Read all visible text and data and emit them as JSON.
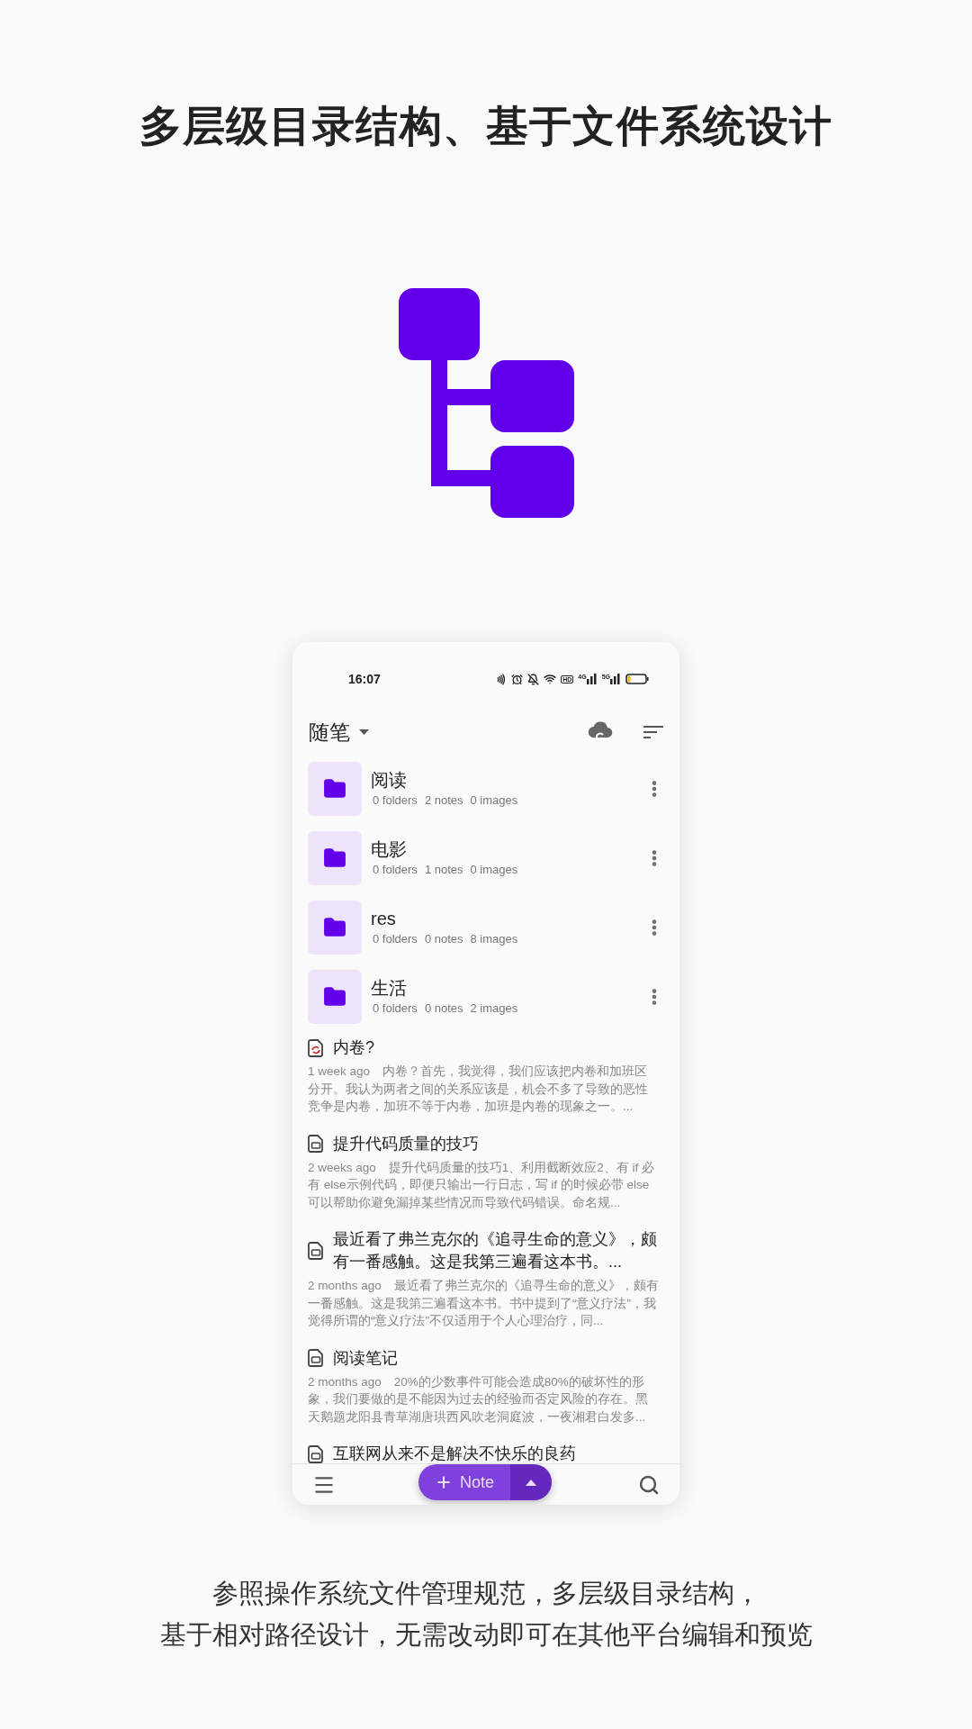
{
  "headline": "多层级目录结构、基于文件系统设计",
  "phone": {
    "status_bar": {
      "time": "16:07",
      "hd_label": "HD",
      "network_labels": [
        "4G",
        "5G"
      ]
    },
    "header": {
      "title": "随笔"
    },
    "folders": [
      {
        "name": "阅读",
        "folders": "0 folders",
        "notes": "2 notes",
        "images": "0 images"
      },
      {
        "name": "电影",
        "folders": "0 folders",
        "notes": "1 notes",
        "images": "0 images"
      },
      {
        "name": "res",
        "folders": "0 folders",
        "notes": "0 notes",
        "images": "8 images"
      },
      {
        "name": "生活",
        "folders": "0 folders",
        "notes": "0 notes",
        "images": "2 images"
      }
    ],
    "notes": [
      {
        "title": "内卷?",
        "syncing": true,
        "time": "1 week ago",
        "preview": "内卷？首先，我觉得，我们应该把内卷和加班区分开。我认为两者之间的关系应该是，机会不多了导致的恶性竞争是内卷，加班不等于内卷，加班是内卷的现象之一。..."
      },
      {
        "title": "提升代码质量的技巧",
        "syncing": false,
        "time": "2 weeks ago",
        "preview": "提升代码质量的技巧1、利用截断效应2、有 if 必有 else示例代码，即便只输出一行日志，写 if 的时候必带 else 可以帮助你避免漏掉某些情况而导致代码错误。命名规..."
      },
      {
        "title": "最近看了弗兰克尔的《追寻生命的意义》，颇有一番感触。这是我第三遍看这本书。...",
        "syncing": false,
        "time": "2 months ago",
        "preview": "最近看了弗兰克尔的《追寻生命的意义》，颇有一番感触。这是我第三遍看这本书。书中提到了“意义疗法”，我觉得所谓的“意义疗法”不仅适用于个人心理治疗，同..."
      },
      {
        "title": "阅读笔记",
        "syncing": false,
        "time": "2 months ago",
        "preview": "20%的少数事件可能会造成80%的破坏性的形象，我们要做的是不能因为过去的经验而否定风险的存在。黑天鹅题龙阳县青草湖唐珙西风吹老洞庭波，一夜湘君白发多..."
      },
      {
        "title": "互联网从来不是解决不快乐的良药",
        "syncing": false
      }
    ],
    "fab": {
      "label": "Note"
    }
  },
  "caption": [
    "参照操作系统文件管理规范，多层级目录结构，",
    "基于相对路径设计，无需改动即可在其他平台编辑和预览"
  ]
}
